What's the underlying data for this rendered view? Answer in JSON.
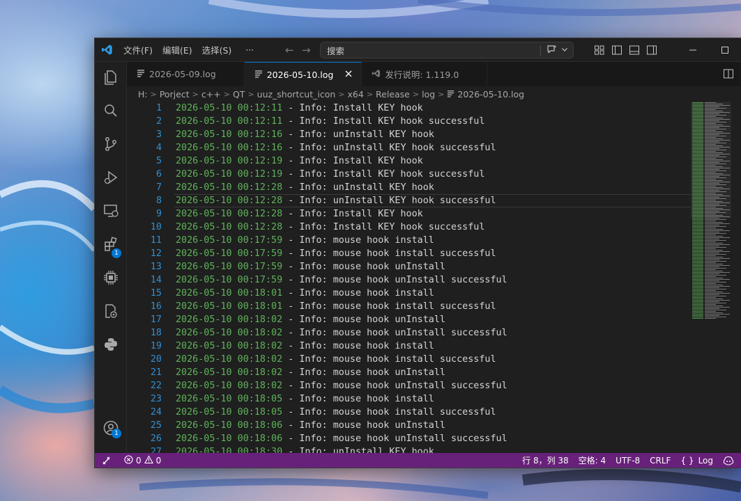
{
  "titlebar": {
    "menu": [
      "文件(F)",
      "编辑(E)",
      "选择(S)",
      "···"
    ],
    "search_placeholder": "搜索"
  },
  "activity": {
    "extensions_badge": "1",
    "accounts_badge": "1"
  },
  "tabs": [
    {
      "label": "2026-05-09.log",
      "active": false
    },
    {
      "label": "2026-05-10.log",
      "active": true
    },
    {
      "label": "发行说明: 1.119.0",
      "active": false
    }
  ],
  "breadcrumb": [
    "H:",
    "Porject",
    "c++",
    "QT",
    "uuz_shortcut_icon",
    "x64",
    "Release",
    "log",
    "2026-05-10.log"
  ],
  "current_line": 8,
  "lines": [
    {
      "n": "1",
      "ts": "2026-05-10 00:12:11",
      "level": "Info:",
      "msg": "Install KEY hook"
    },
    {
      "n": "2",
      "ts": "2026-05-10 00:12:11",
      "level": "Info:",
      "msg": "Install KEY hook successful"
    },
    {
      "n": "3",
      "ts": "2026-05-10 00:12:16",
      "level": "Info:",
      "msg": "unInstall KEY hook"
    },
    {
      "n": "4",
      "ts": "2026-05-10 00:12:16",
      "level": "Info:",
      "msg": "unInstall KEY hook successful"
    },
    {
      "n": "5",
      "ts": "2026-05-10 00:12:19",
      "level": "Info:",
      "msg": "Install KEY hook"
    },
    {
      "n": "6",
      "ts": "2026-05-10 00:12:19",
      "level": "Info:",
      "msg": "Install KEY hook successful"
    },
    {
      "n": "7",
      "ts": "2026-05-10 00:12:28",
      "level": "Info:",
      "msg": "unInstall KEY hook"
    },
    {
      "n": "8",
      "ts": "2026-05-10 00:12:28",
      "level": "Info:",
      "msg": "unInstall KEY hook successful"
    },
    {
      "n": "9",
      "ts": "2026-05-10 00:12:28",
      "level": "Info:",
      "msg": "Install KEY hook"
    },
    {
      "n": "10",
      "ts": "2026-05-10 00:12:28",
      "level": "Info:",
      "msg": "Install KEY hook successful"
    },
    {
      "n": "11",
      "ts": "2026-05-10 00:17:59",
      "level": "Info:",
      "msg": "mouse hook install"
    },
    {
      "n": "12",
      "ts": "2026-05-10 00:17:59",
      "level": "Info:",
      "msg": "mouse hook install successful"
    },
    {
      "n": "13",
      "ts": "2026-05-10 00:17:59",
      "level": "Info:",
      "msg": "mouse hook unInstall"
    },
    {
      "n": "14",
      "ts": "2026-05-10 00:17:59",
      "level": "Info:",
      "msg": "mouse hook unInstall successful"
    },
    {
      "n": "15",
      "ts": "2026-05-10 00:18:01",
      "level": "Info:",
      "msg": "mouse hook install"
    },
    {
      "n": "16",
      "ts": "2026-05-10 00:18:01",
      "level": "Info:",
      "msg": "mouse hook install successful"
    },
    {
      "n": "17",
      "ts": "2026-05-10 00:18:02",
      "level": "Info:",
      "msg": "mouse hook unInstall"
    },
    {
      "n": "18",
      "ts": "2026-05-10 00:18:02",
      "level": "Info:",
      "msg": "mouse hook unInstall successful"
    },
    {
      "n": "19",
      "ts": "2026-05-10 00:18:02",
      "level": "Info:",
      "msg": "mouse hook install"
    },
    {
      "n": "20",
      "ts": "2026-05-10 00:18:02",
      "level": "Info:",
      "msg": "mouse hook install successful"
    },
    {
      "n": "21",
      "ts": "2026-05-10 00:18:02",
      "level": "Info:",
      "msg": "mouse hook unInstall"
    },
    {
      "n": "22",
      "ts": "2026-05-10 00:18:02",
      "level": "Info:",
      "msg": "mouse hook unInstall successful"
    },
    {
      "n": "23",
      "ts": "2026-05-10 00:18:05",
      "level": "Info:",
      "msg": "mouse hook install"
    },
    {
      "n": "24",
      "ts": "2026-05-10 00:18:05",
      "level": "Info:",
      "msg": "mouse hook install successful"
    },
    {
      "n": "25",
      "ts": "2026-05-10 00:18:06",
      "level": "Info:",
      "msg": "mouse hook unInstall"
    },
    {
      "n": "26",
      "ts": "2026-05-10 00:18:06",
      "level": "Info:",
      "msg": "mouse hook unInstall successful"
    },
    {
      "n": "27",
      "ts": "2026-05-10 00:18:30",
      "level": "Info:",
      "msg": "unInstall KEY hook"
    }
  ],
  "statusbar": {
    "errors": "0",
    "warnings": "0",
    "cursor": "行 8，列 38",
    "indent": "空格: 4",
    "encoding": "UTF-8",
    "eol": "CRLF",
    "language": "Log"
  },
  "colors": {
    "statusbar": "#68217a",
    "accent": "#0078d4",
    "timestamp": "#5fb35a",
    "line_number": "#2f8fd3"
  }
}
